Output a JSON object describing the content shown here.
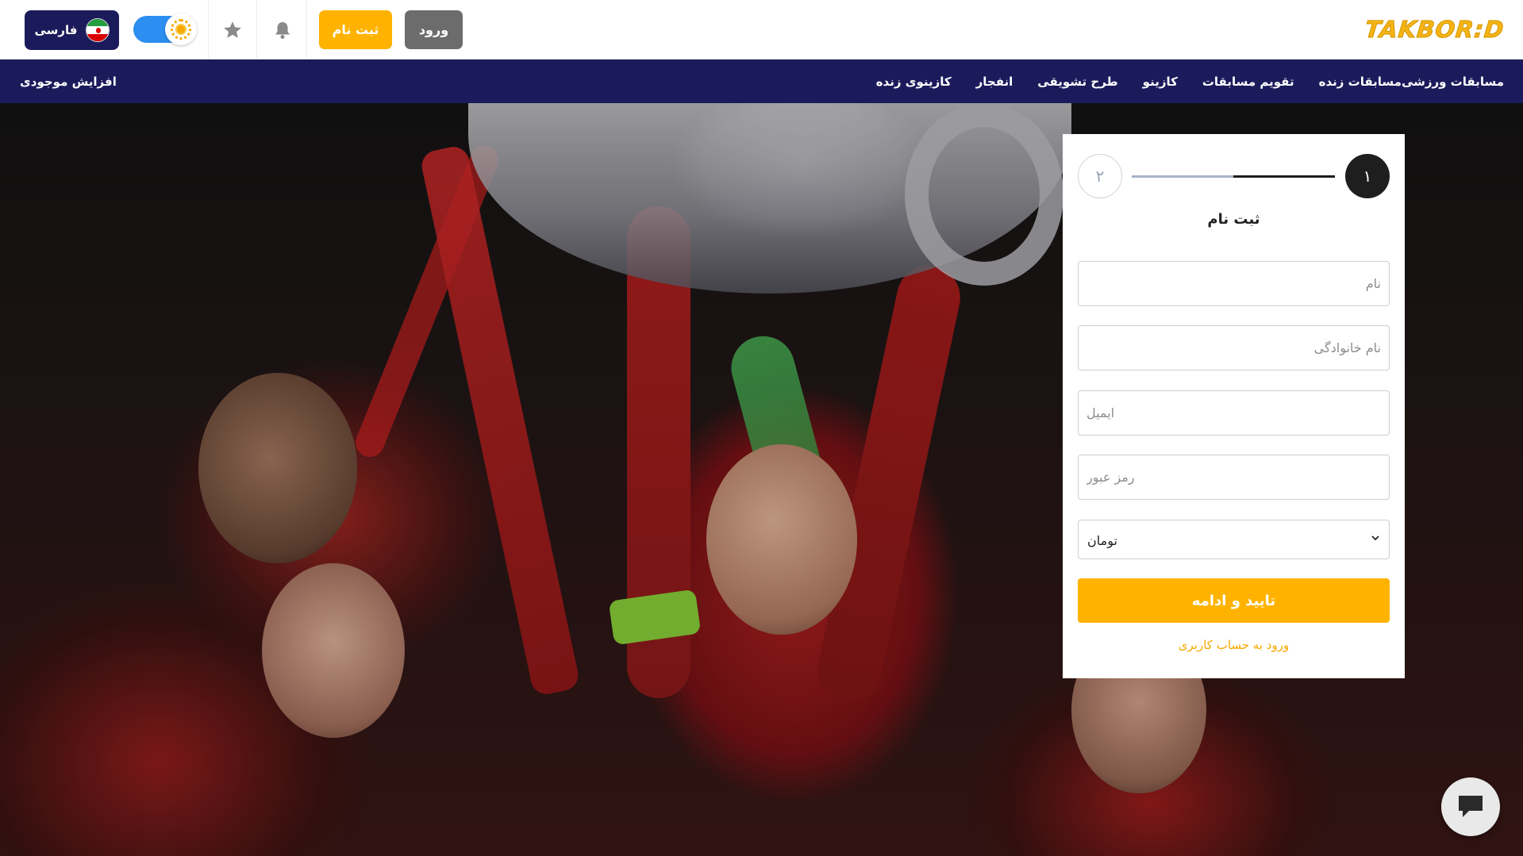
{
  "header": {
    "logo_text": "TAKBOR:D",
    "language_label": "فارسی",
    "login_label": "ورود",
    "register_label": "ثبت نام",
    "icons": [
      "iran-flag-icon",
      "sun-icon",
      "star-icon",
      "bell-icon"
    ]
  },
  "nav": {
    "items": [
      "مسابقات ورزشی",
      "مسابقات زنده",
      "تقویم مسابقات",
      "کازینو",
      "طرح تشویقی",
      "انفجار",
      "کازینوی زنده"
    ],
    "balance_label": "افزایش موجودی"
  },
  "registration": {
    "step1": "۱",
    "step2": "۲",
    "title": "ثبت نام",
    "name_placeholder": "نام",
    "family_placeholder": "نام خانوادگی",
    "email_placeholder": "ایمیل",
    "password_placeholder": "رمز عبور",
    "currency_value": "تومان",
    "submit_label": "تایید و ادامه",
    "login_link": "ورود به حساب کاربری"
  },
  "chat": {
    "icon": "chat-icon"
  },
  "colors": {
    "brand_navy": "#1b1b5c",
    "accent_yellow": "#ffb300",
    "login_gray": "#6c6c6c",
    "toggle_blue": "#2b8ef0"
  }
}
